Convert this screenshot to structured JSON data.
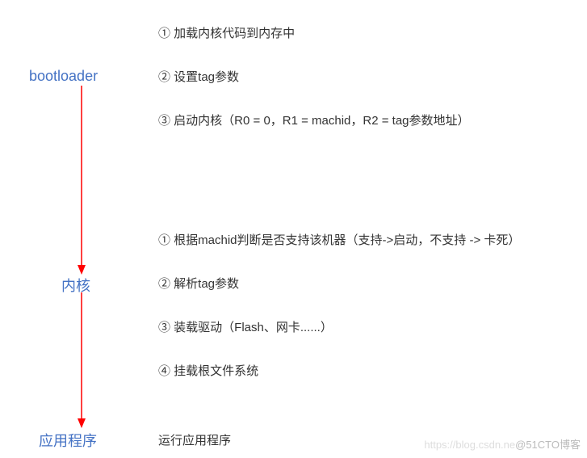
{
  "stages": {
    "bootloader": "bootloader",
    "kernel": "内核",
    "app": "应用程序"
  },
  "bootloader_items": [
    "① 加载内核代码到内存中",
    "② 设置tag参数",
    "③ 启动内核（R0 = 0，R1 = machid，R2 = tag参数地址）"
  ],
  "kernel_items": [
    "① 根据machid判断是否支持该机器（支持->启动，不支持 -> 卡死）",
    "② 解析tag参数",
    "③ 装载驱动（Flash、网卡......）",
    "④ 挂载根文件系统"
  ],
  "app_items": [
    "运行应用程序"
  ],
  "watermark": {
    "left": "https://blog.csdn.ne",
    "right": "@51CTO博客"
  },
  "colors": {
    "stage_label": "#4472c4",
    "arrow": "#ff0000",
    "text": "#333333"
  }
}
